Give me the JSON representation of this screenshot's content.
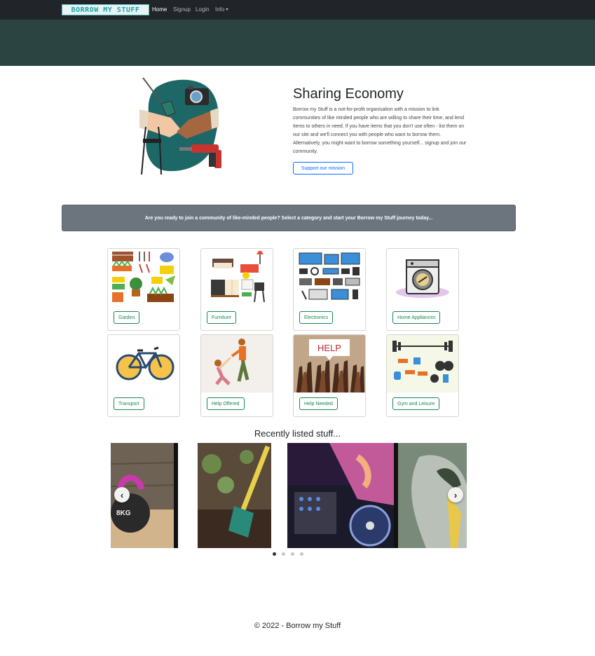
{
  "navbar": {
    "logo_text": "BORROW MY STUFF",
    "links": [
      "Home",
      "Signup",
      "Login",
      "Info"
    ],
    "active_link": "Home"
  },
  "hero": {
    "title": "Sharing Economy",
    "text": "Borrow my Stuff is a not-for-profit organisation with a mission to link communities of like minded people who are willing to share their time, and lend items to others in need. If you have items that you don't use often - list them on our site and we'll connect you with people who want to borrow them. Alternatively, you might want to borrow something yourself... signup and join our community.",
    "button": "Support our mission"
  },
  "cta": {
    "text": "Are you ready to join a community of like-minded people? Select a category and start your Borrow my Stuff journey today..."
  },
  "categories": [
    {
      "label": "Garden"
    },
    {
      "label": "Furniture"
    },
    {
      "label": "Electronics"
    },
    {
      "label": "Home Appliances"
    },
    {
      "label": "Transport"
    },
    {
      "label": "Help Offered"
    },
    {
      "label": "Help Needed",
      "image_text": "HELP"
    },
    {
      "label": "Gym and Leisure"
    }
  ],
  "recent": {
    "title": "Recently listed stuff...",
    "kettlebell_text": "8KG",
    "slides": [
      "kettlebell",
      "shovel",
      "dj-controller",
      "car-door"
    ],
    "active_dot": 0
  },
  "footer": {
    "text": "© 2022 - Borrow my Stuff"
  },
  "colors": {
    "navbar": "#212529",
    "banner": "#2b4442",
    "primary": "#0d6efd",
    "success": "#198754",
    "secondary": "#6c757d"
  }
}
